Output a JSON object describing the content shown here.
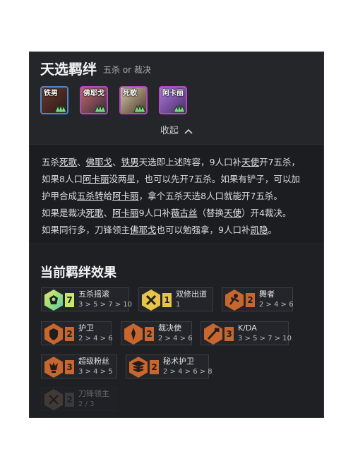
{
  "header": {
    "title": "天选羁绊",
    "subtitle": "五杀 or 裁决"
  },
  "champions": [
    {
      "label": "铁男",
      "border": "#4a86c8",
      "bg": "#3a2a2a"
    },
    {
      "label": "佛耶戈",
      "border": "#b14ac0",
      "bg": "#5a3a4a"
    },
    {
      "label": "死歌",
      "border": "#b14ac0",
      "bg": "#5a4a3a"
    },
    {
      "label": "阿卡丽",
      "border": "#b14ac0",
      "bg": "#6a4a8a"
    }
  ],
  "collapse_label": "收起",
  "description": {
    "line1": [
      "五杀",
      "死歌",
      "、",
      "佛耶戈",
      "、",
      "铁男",
      "天选即上述阵容，9人口补",
      "天使",
      "开7五杀，"
    ],
    "line2": [
      "如果8人口",
      "阿卡丽",
      "没两星，也可以先开7五杀。如果有铲子，可以加"
    ],
    "line3": [
      "护甲合成",
      "五杀转",
      "给",
      "阿卡丽",
      "，拿个五杀天选8人口就能开7五杀。"
    ],
    "line4": [
      "如果是裁决",
      "死歌",
      "、",
      "阿卡丽",
      "9人口补",
      "薇古丝",
      "（替换",
      "天使",
      "）开4裁决。"
    ],
    "line5": [
      "如果同行多，刀锋领主",
      "佛耶戈",
      "也可以勉强拿，9人口补",
      "凯隐",
      "。"
    ]
  },
  "effects_title": "当前羁绊效果",
  "traits": [
    {
      "name": "五杀摇滚",
      "count": "7",
      "steps": "3 > 5 > 7 > 10",
      "tier": "prismatic"
    },
    {
      "name": "双修出道",
      "count": "1",
      "steps": "1",
      "tier": "gold"
    },
    {
      "name": "舞者",
      "count": "2",
      "steps": "2 > 4 > 6",
      "tier": "bronze"
    },
    {
      "name": "护卫",
      "count": "2",
      "steps": "2 > 4 > 6",
      "tier": "bronze"
    },
    {
      "name": "裁决使",
      "count": "2",
      "steps": "2 > 4 > 6",
      "tier": "bronze"
    },
    {
      "name": "K/DA",
      "count": "3",
      "steps": "3 > 5 > 7 > 10",
      "tier": "bronze"
    },
    {
      "name": "超级粉丝",
      "count": "3",
      "steps": "3 > 4 > 5",
      "tier": "bronze"
    },
    {
      "name": "秘术护卫",
      "count": "2",
      "steps": "2 > 4 > 6 > 8",
      "tier": "bronze"
    },
    {
      "name": "刀锋领主",
      "count": "2",
      "steps": "2 / 3",
      "tier": "inactive"
    }
  ],
  "colors": {
    "bronze": "#c8662e",
    "gold": "#e6c34a",
    "prismatic": "#c9e86a",
    "panel": "#1e2024"
  }
}
